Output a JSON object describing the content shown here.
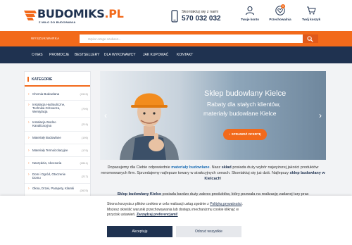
{
  "header": {
    "logo_main": "BUDOMIKS",
    "logo_tld": ".PL",
    "logo_tagline": "Z MIŁO DO BUDOWANIA",
    "contact_label": "Skontaktuj się z nami",
    "contact_phone": "570 032 032",
    "account_label": "Twoje konto",
    "wishlist_label": "Przechowalnia",
    "wishlist_count": "0",
    "cart_label": "Twój koszyk"
  },
  "search": {
    "label": "WYSZUKIWARKA",
    "placeholder": "Wpisz czego szukasz..."
  },
  "nav": [
    "O NAS",
    "PROMOCJE",
    "BESTSELLERY",
    "DLA WYKONAWCY",
    "JAK KUPOWAĆ",
    "KONTAKT"
  ],
  "sidebar": {
    "title": "KATEGORIE",
    "items": [
      {
        "name": "Chemia Budowlana",
        "count": "(1515)"
      },
      {
        "name": "Instalacja Hydrauliczne, Technika Grzewcza, Wentylacja",
        "count": "(799)"
      },
      {
        "name": "Instalacja Wodno Kanalizacyjna",
        "count": "(219)"
      },
      {
        "name": "Materiały Budowlane",
        "count": "(195)"
      },
      {
        "name": "Materiały Termoizolacyjne",
        "count": "(176)"
      },
      {
        "name": "Narzędzia, Akcesoria",
        "count": "(2841)"
      },
      {
        "name": "Dom i Ogród, Otoczenie Domu",
        "count": "(217)"
      },
      {
        "name": "Okna, Drzwi, Parapety, Klamki",
        "count": "(2625)"
      }
    ]
  },
  "hero": {
    "title": "Sklep budowlany Kielce",
    "subtitle_line1": "Rabaty dla stałych klientów,",
    "subtitle_line2": "materiały budowlane Kielce",
    "button": "SPRAWDŹ OFERTĘ"
  },
  "intro": {
    "p1_a": "Dopasujemy dla Ciebie odpowiednie ",
    "p1_link": "materiały budowlane",
    "p1_b": ". Nasz ",
    "p1_bold": "skład",
    "p1_c": " posiada duży wybór najwyższej jakości produktów renomowanych firm. Sprzedajemy najlepsze towary w atrakcyjnych cenach. Skontaktuj się już dziś. Najlepszy ",
    "p1_bold2": "sklep budowlany w Kielcach",
    "p1_d": "!",
    "p2_bold": "Sklep budowlany Kielce",
    "p2_rest": " posiada bardzo duży zakres produktów, który pozwala na realizację zadanej tury prac"
  },
  "cookie": {
    "text_a": "Strona korzysta z plików cookies w celu realizacji usług zgodnie z ",
    "policy_link": "Polityką prywatności",
    "text_b": ". Możesz określić warunki przechowywania lub dostępu mechanizmu cookie kliknąć w przycisk ustawień. ",
    "pref_link": "Zarządzaj preferencjami!",
    "accept": "Akceptuję",
    "reject": "Odrzuć wszystkie"
  }
}
